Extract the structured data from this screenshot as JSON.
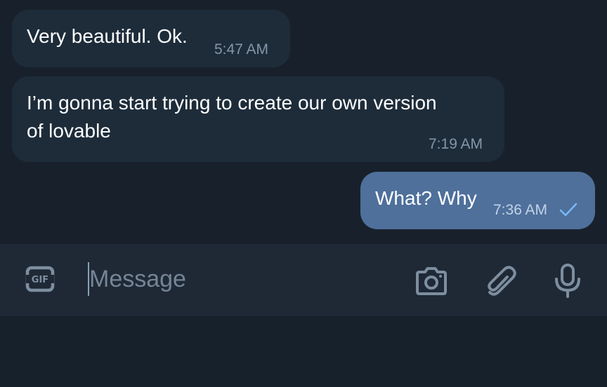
{
  "messages": [
    {
      "direction": "incoming",
      "lines": [
        "Very beautiful. Ok."
      ],
      "time": "5:47 AM"
    },
    {
      "direction": "incoming",
      "lines": [
        "I’m gonna start trying to create our own version",
        "of lovable"
      ],
      "time": "7:19 AM"
    },
    {
      "direction": "outgoing",
      "lines": [
        "What? Why"
      ],
      "time": "7:36 AM",
      "status_icon": "single-check-icon"
    }
  ],
  "composer": {
    "placeholder": "Message",
    "value": "",
    "icons": [
      "gif-icon",
      "camera-icon",
      "attach-icon",
      "mic-icon"
    ]
  },
  "colors": {
    "background": "#17212b",
    "incoming_bubble": "#1e2c3a",
    "outgoing_bubble": "#4e709b",
    "composer_bar": "#1f2935",
    "check_accent": "#7ab8f5"
  }
}
